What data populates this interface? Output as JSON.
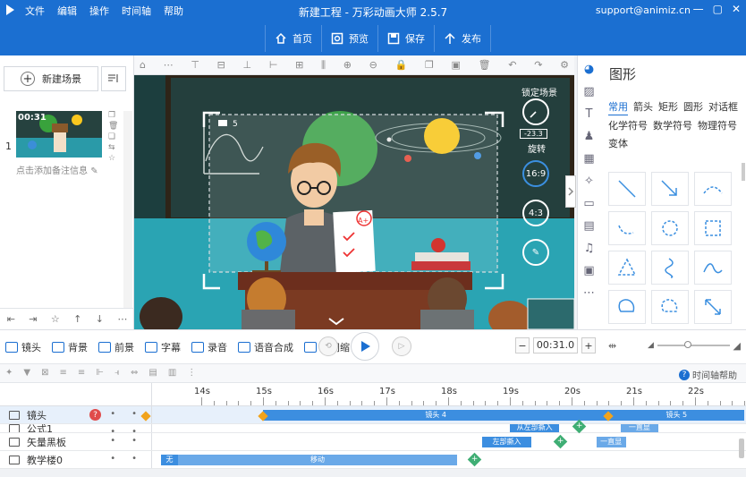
{
  "app": {
    "menu": [
      "文件",
      "编辑",
      "操作",
      "时间轴",
      "帮助"
    ],
    "title": "新建工程 - 万彩动画大师 2.5.7",
    "account": "support@animiz.cn",
    "toolbar": [
      {
        "label": "首页",
        "icon": "home-icon"
      },
      {
        "label": "预览",
        "icon": "preview-icon"
      },
      {
        "label": "保存",
        "icon": "save-icon"
      },
      {
        "label": "发布",
        "icon": "publish-icon"
      }
    ]
  },
  "scenes": {
    "new_scene": "新建场景",
    "items": [
      {
        "num": "1",
        "time": "00:31",
        "note": "点击添加备注信息"
      }
    ]
  },
  "canvas": {
    "lock_scene": "锁定场景",
    "rotation_value": "-23.3",
    "rotation_label": "旋转",
    "ratio_169": "16:9",
    "ratio_43": "4:3",
    "camera_index": "5",
    "paper_grade": "A+"
  },
  "shapes": {
    "title": "图形",
    "tabs": [
      "常用",
      "箭头",
      "矩形",
      "圆形",
      "对话框",
      "化学符号",
      "数学符号",
      "物理符号",
      "变体"
    ],
    "active_tab": "常用"
  },
  "timeline": {
    "tools": [
      "镜头",
      "背景",
      "前景",
      "字幕",
      "录音",
      "语音合成",
      "时间缩"
    ],
    "current_time": "00:31.0",
    "help": "时间轴帮助",
    "ticks": [
      "14s",
      "15s",
      "16s",
      "17s",
      "18s",
      "19s",
      "20s",
      "21s",
      "22s"
    ],
    "tracks": [
      {
        "name": "镜头",
        "bars": [
          {
            "label": "镜头 4",
            "start": 15.0,
            "end": 20.6
          },
          {
            "label": "镜头 5",
            "start": 20.6,
            "end": 22.8
          }
        ]
      },
      {
        "name": "公式1",
        "bars": [
          {
            "label": "从左部撕入",
            "start": 19.0,
            "end": 19.8
          },
          {
            "label": "一直显",
            "start": 20.8,
            "end": 21.4
          }
        ]
      },
      {
        "name": "矢量黑板",
        "bars": [
          {
            "label": "左部撕入",
            "start": 18.55,
            "end": 19.35
          },
          {
            "label": "一直显",
            "start": 20.4,
            "end": 20.88
          }
        ]
      },
      {
        "name": "教学楼0",
        "bars": [
          {
            "label": "无",
            "start": 13.35,
            "end": 13.62
          },
          {
            "label": "移动",
            "start": 13.62,
            "end": 18.15
          }
        ]
      }
    ]
  },
  "colors": {
    "brand": "#1b6fd1",
    "track_bar": "#3c8ee0",
    "keyframe_gold": "#f1a31c",
    "keyframe_green": "#3fae74"
  }
}
